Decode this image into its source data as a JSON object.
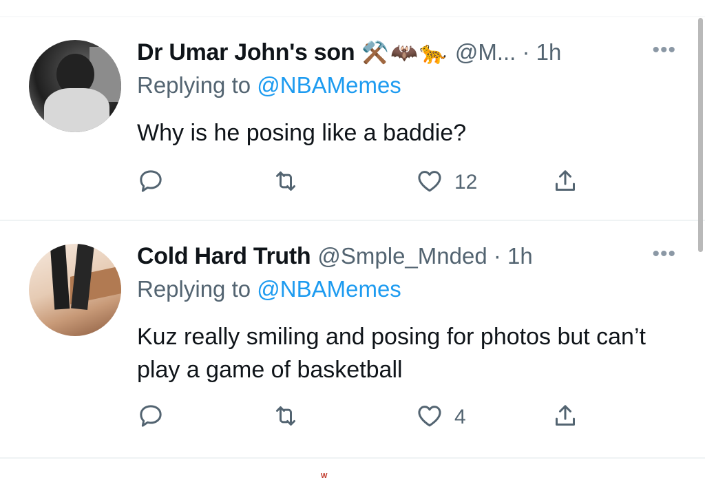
{
  "tweets": [
    {
      "display_name": "Dr Umar John's son",
      "name_emojis": "⚒️🦇🐆",
      "handle_time": "@M... · 1h",
      "replying_prefix": "Replying to ",
      "replying_handle": "@NBAMemes",
      "text": "Why is he posing like a baddie?",
      "reply_count": "",
      "retweet_count": "",
      "like_count": "12"
    },
    {
      "display_name": "Cold Hard Truth",
      "name_emojis": "",
      "handle_time": "@Smple_Mnded · 1h",
      "replying_prefix": "Replying to ",
      "replying_handle": "@NBAMemes",
      "text": "Kuz really smiling and posing for photos but can’t play a game of basketball",
      "reply_count": "",
      "retweet_count": "",
      "like_count": "4"
    }
  ],
  "more_glyph": "•••",
  "bottom_mark": "W",
  "colors": {
    "accent": "#1d9bf0",
    "secondary_text": "#536471",
    "divider": "#eff3f4"
  },
  "icons": {
    "reply": "reply-icon",
    "retweet": "retweet-icon",
    "like": "heart-icon",
    "share": "share-icon",
    "more": "more-icon"
  }
}
